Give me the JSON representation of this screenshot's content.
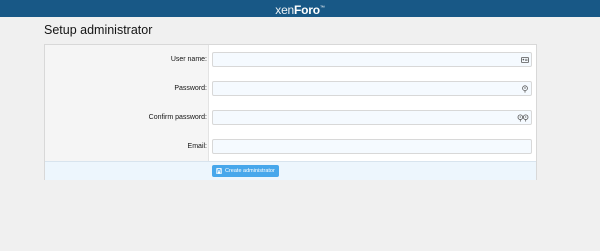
{
  "header": {
    "logo_part1": "xen",
    "logo_part2": "Foro",
    "logo_tm": "™",
    "color": "#185886"
  },
  "page": {
    "title": "Setup administrator"
  },
  "form": {
    "fields": [
      {
        "label": "User name:",
        "value": "",
        "icon": "id-card-icon"
      },
      {
        "label": "Password:",
        "value": "",
        "icon": "key-icon"
      },
      {
        "label": "Confirm password:",
        "value": "",
        "icon": "keys-icon"
      },
      {
        "label": "Email:",
        "value": "",
        "icon": ""
      }
    ],
    "submit_label": "Create administrator",
    "submit_icon": "save-icon",
    "accent": "#47a7eb"
  }
}
